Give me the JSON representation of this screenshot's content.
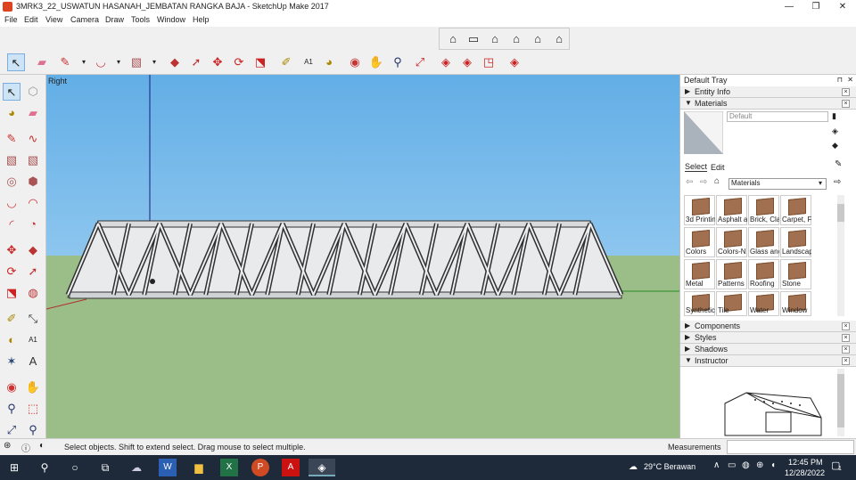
{
  "window": {
    "title": "3MRK3_22_USWATUN HASANAH_JEMBATAN RANGKA BAJA - SketchUp Make 2017",
    "min": "—",
    "max": "❐",
    "close": "✕"
  },
  "menu": [
    "File",
    "Edit",
    "View",
    "Camera",
    "Draw",
    "Tools",
    "Window",
    "Help"
  ],
  "viewport": {
    "scene_label": "Right"
  },
  "tray": {
    "title": "Default Tray",
    "entity_info": "Entity Info",
    "materials": "Materials",
    "current_material": "Default",
    "select_tab": "Select",
    "edit_tab": "Edit",
    "library": "Materials",
    "items": [
      "3d Printin",
      "Asphalt a",
      "Brick, Cla",
      "Carpet, F",
      "Colors",
      "Colors-N",
      "Glass anc",
      "Landscap",
      "Metal",
      "Patterns",
      "Roofing",
      "Stone",
      "Synthetic",
      "Tile",
      "Water",
      "Window"
    ],
    "components": "Components",
    "styles": "Styles",
    "shadows": "Shadows",
    "instructor": "Instructor"
  },
  "status": {
    "hint": "Select objects. Shift to extend select. Drag mouse to select multiple.",
    "measurements": "Measurements"
  },
  "taskbar": {
    "weather": "29°C  Berawan",
    "time": "12:45 PM",
    "date": "12/28/2022",
    "notifications": "1"
  }
}
